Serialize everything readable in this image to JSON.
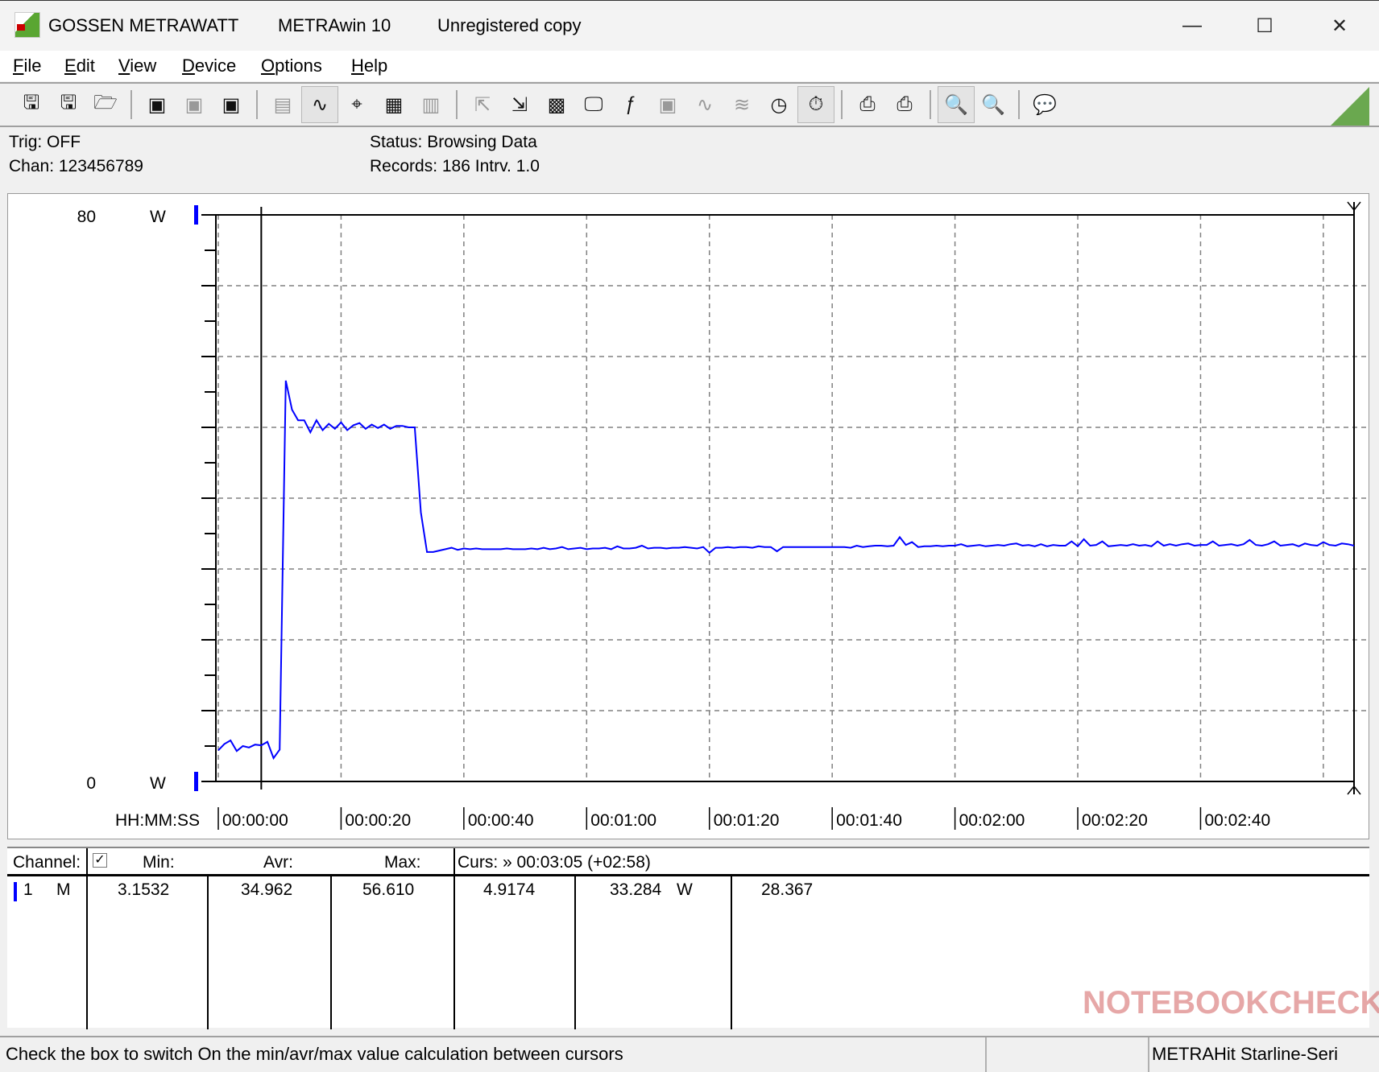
{
  "titlebar": {
    "company": "GOSSEN METRAWATT",
    "app": "METRAwin 10",
    "registration": "Unregistered copy",
    "minimize": "—",
    "maximize": "☐",
    "close": "✕"
  },
  "menu": [
    "File",
    "Edit",
    "View",
    "Device",
    "Options",
    "Help"
  ],
  "toolbar": {
    "groups": [
      [
        {
          "icon": "save-icon",
          "glyph": "🖫"
        },
        {
          "icon": "save-as-icon",
          "glyph": "🖫"
        },
        {
          "icon": "open-folder-icon",
          "glyph": "🗁"
        }
      ],
      [
        {
          "icon": "device-read-icon",
          "glyph": "▣"
        },
        {
          "icon": "device-disabled-icon",
          "glyph": "▣",
          "disabled": true
        },
        {
          "icon": "memory-read-icon",
          "glyph": "▣"
        }
      ],
      [
        {
          "icon": "display-icon",
          "glyph": "▤",
          "disabled": true
        },
        {
          "icon": "graph-view-icon",
          "glyph": "∿",
          "active": true
        },
        {
          "icon": "crosshair-icon",
          "glyph": "⌖"
        },
        {
          "icon": "table-view-icon",
          "glyph": "▦"
        },
        {
          "icon": "bar-view-icon",
          "glyph": "▥",
          "disabled": true
        }
      ],
      [
        {
          "icon": "export-icon",
          "glyph": "⇱",
          "disabled": true
        },
        {
          "icon": "import-icon",
          "glyph": "⇲"
        },
        {
          "icon": "channel-config-icon",
          "glyph": "▩"
        },
        {
          "icon": "monitor-icon",
          "glyph": "🖵"
        },
        {
          "icon": "function-icon",
          "glyph": "ƒ"
        },
        {
          "icon": "device-list-icon",
          "glyph": "▣",
          "disabled": true
        },
        {
          "icon": "signal-icon",
          "glyph": "∿",
          "disabled": true
        },
        {
          "icon": "waveform-icon",
          "glyph": "≋",
          "disabled": true
        },
        {
          "icon": "clock-settings-icon",
          "glyph": "◷"
        },
        {
          "icon": "timer-icon",
          "glyph": "⏱",
          "active": true
        }
      ],
      [
        {
          "icon": "print-preview-icon",
          "glyph": "⎙"
        },
        {
          "icon": "print-icon",
          "glyph": "⎙"
        }
      ],
      [
        {
          "icon": "zoom-all-icon",
          "glyph": "🔍",
          "active": true
        },
        {
          "icon": "zoom-curve-icon",
          "glyph": "🔍"
        }
      ],
      [
        {
          "icon": "comment-icon",
          "glyph": "💬"
        }
      ]
    ]
  },
  "info": {
    "trig": "Trig: OFF",
    "chan": "Chan:  123456789",
    "status": "Status:   Browsing Data",
    "records": "Records: 186   Intrv. 1.0"
  },
  "chart_data": {
    "type": "line",
    "ylabel_unit": "W",
    "ytick_labels": {
      "top": "80",
      "bottom": "0"
    },
    "ylim": [
      0,
      80
    ],
    "xlabel": "HH:MM:SS",
    "xtick_labels": [
      "00:00:00",
      "00:00:20",
      "00:00:40",
      "00:01:00",
      "00:01:20",
      "00:01:40",
      "00:02:00",
      "00:02:20",
      "00:02:40"
    ],
    "xlim_seconds": [
      0,
      185
    ],
    "grid": true,
    "cursor1_seconds": 7,
    "cursor2_seconds": 185,
    "line_color": "#0000ff",
    "series": [
      {
        "interval_s": 1,
        "values": [
          4.4,
          5.3,
          5.8,
          4.3,
          5.0,
          4.8,
          5.2,
          5.1,
          5.6,
          3.3,
          4.5,
          56.6,
          52.5,
          51.0,
          51.0,
          49.3,
          51.0,
          49.6,
          50.5,
          49.8,
          50.7,
          49.6,
          50.3,
          50.6,
          49.8,
          50.4,
          49.9,
          50.4,
          49.8,
          50.2,
          50.2,
          50.0,
          50.0,
          38.0,
          32.4,
          32.4,
          32.6,
          32.8,
          33.0,
          32.7,
          32.9,
          32.8,
          32.9,
          32.8,
          32.8,
          32.8,
          32.8,
          32.9,
          32.8,
          32.8,
          32.8,
          32.9,
          32.8,
          33.0,
          32.8,
          32.9,
          33.1,
          32.8,
          32.9,
          33.0,
          32.8,
          32.9,
          32.9,
          33.0,
          32.8,
          33.2,
          32.9,
          32.9,
          33.0,
          33.3,
          32.9,
          33.0,
          33.0,
          32.9,
          33.0,
          33.0,
          33.1,
          33.0,
          32.9,
          33.1,
          32.3,
          33.0,
          33.0,
          33.1,
          33.0,
          33.1,
          33.1,
          33.0,
          33.2,
          33.1,
          33.1,
          32.5,
          33.1,
          33.1,
          33.1,
          33.1,
          33.1,
          33.1,
          33.1,
          33.1,
          33.1,
          33.1,
          33.1,
          33.0,
          33.3,
          33.1,
          33.2,
          33.3,
          33.3,
          33.2,
          33.3,
          34.5,
          33.4,
          33.8,
          33.1,
          33.2,
          33.2,
          33.3,
          33.2,
          33.3,
          33.3,
          33.5,
          33.2,
          33.3,
          33.4,
          33.2,
          33.3,
          33.4,
          33.3,
          33.5,
          33.6,
          33.3,
          33.4,
          33.2,
          33.5,
          33.2,
          33.4,
          33.3,
          33.3,
          33.9,
          33.2,
          34.2,
          33.3,
          33.4,
          33.9,
          33.2,
          33.3,
          33.4,
          33.3,
          33.5,
          33.3,
          33.4,
          33.2,
          33.9,
          33.3,
          33.5,
          33.3,
          33.5,
          33.6,
          33.3,
          33.4,
          33.4,
          33.9,
          33.3,
          33.4,
          33.5,
          33.3,
          33.5,
          34.1,
          33.4,
          33.3,
          33.5,
          33.9,
          33.3,
          33.4,
          33.5,
          33.2,
          33.6,
          33.4,
          33.3,
          33.8,
          33.4,
          33.3,
          33.6,
          33.5,
          33.3
        ]
      }
    ]
  },
  "table": {
    "headers": {
      "channel": "Channel:",
      "min": "Min:",
      "avr": "Avr:",
      "max": "Max:",
      "cursor": "Curs: » 00:03:05 (+02:58)"
    },
    "checkbox_checked": true,
    "row": {
      "channel": "1",
      "mode": "M",
      "min": "3.1532",
      "avr": "34.962",
      "max": "56.610",
      "c1": "4.9174",
      "c2": "33.284",
      "unit": "W",
      "diff": "28.367",
      "color": "#0000ff"
    }
  },
  "statusbar": {
    "hint": "Check the box to switch On the min/avr/max value calculation between cursors",
    "device": "METRAHit Starline-Seri"
  },
  "watermark": "NOTEBOOKCHECK"
}
